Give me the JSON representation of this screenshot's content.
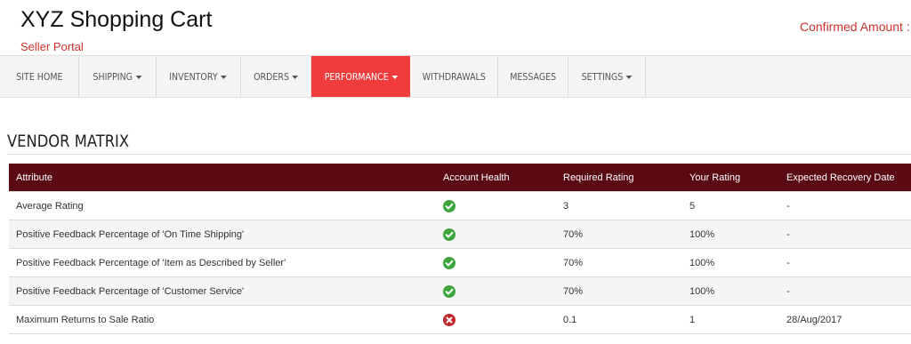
{
  "header": {
    "title": "XYZ Shopping Cart",
    "subtitle": "Seller Portal",
    "confirmed_amount_label": "Confirmed Amount :"
  },
  "nav": {
    "items": [
      {
        "label": "SITE HOME",
        "dropdown": false
      },
      {
        "label": "SHIPPING",
        "dropdown": true
      },
      {
        "label": "INVENTORY",
        "dropdown": true
      },
      {
        "label": "ORDERS",
        "dropdown": true
      },
      {
        "label": "PERFORMANCE",
        "dropdown": true,
        "active": true
      },
      {
        "label": "WITHDRAWALS",
        "dropdown": false
      },
      {
        "label": "MESSAGES",
        "dropdown": false
      },
      {
        "label": "SETTINGS",
        "dropdown": true
      }
    ]
  },
  "section": {
    "title": "VENDOR MATRIX"
  },
  "table": {
    "headers": [
      "Attribute",
      "Account Health",
      "Required Rating",
      "Your Rating",
      "Expected Recovery Date"
    ],
    "rows": [
      {
        "attribute": "Average Rating",
        "health": "check-icon",
        "required": "3",
        "yours": "5",
        "recovery": "-"
      },
      {
        "attribute": "Positive Feedback Percentage of 'On Time Shipping'",
        "health": "check-icon",
        "required": "70%",
        "yours": "100%",
        "recovery": "-"
      },
      {
        "attribute": "Positive Feedback Percentage of 'Item as Described by Seller'",
        "health": "check-icon",
        "required": "70%",
        "yours": "100%",
        "recovery": "-"
      },
      {
        "attribute": "Positive Feedback Percentage of 'Customer Service'",
        "health": "check-icon",
        "required": "70%",
        "yours": "100%",
        "recovery": "-"
      },
      {
        "attribute": "Maximum Returns to Sale Ratio",
        "health": "cross-icon",
        "required": "0.1",
        "yours": "1",
        "recovery": "28/Aug/2017"
      }
    ]
  },
  "colors": {
    "brand_red": "#c9302c",
    "nav_active": "#f03c3c",
    "table_header": "#5a0a12",
    "ok_green": "#3ca63c",
    "error_red": "#c0272d"
  }
}
